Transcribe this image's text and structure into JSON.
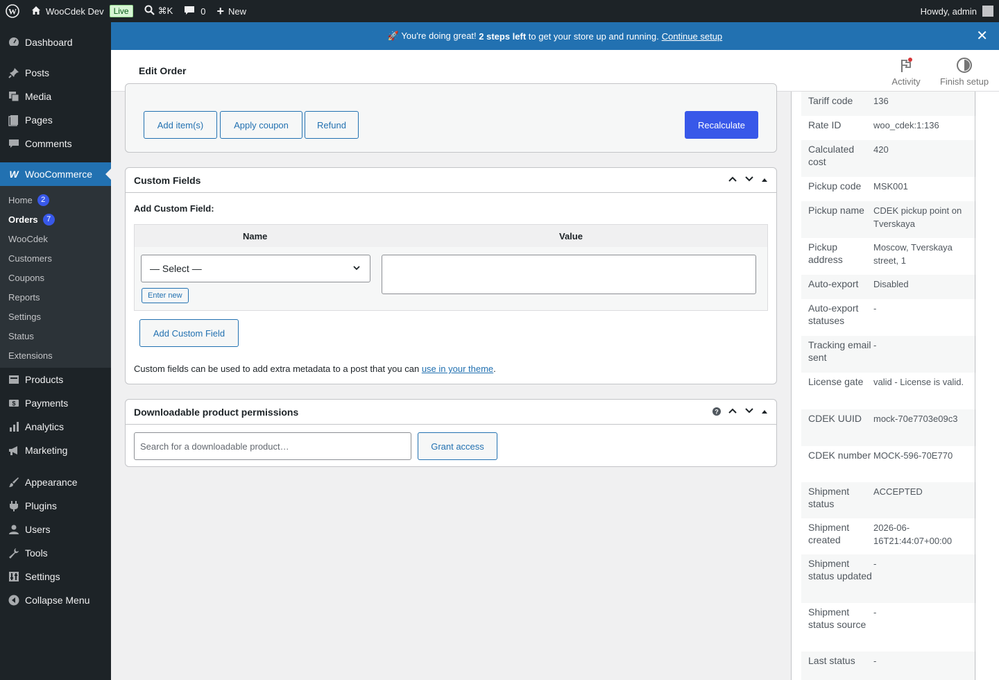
{
  "adminbar": {
    "site_name": "WooCdek Dev",
    "live_label": "Live",
    "search_shortcut": "⌘K",
    "comments_count": "0",
    "new_label": "New",
    "greeting": "Howdy, admin"
  },
  "sidebar": {
    "dashboard": "Dashboard",
    "posts": "Posts",
    "media": "Media",
    "pages": "Pages",
    "comments": "Comments",
    "woocommerce": "WooCommerce",
    "sub": {
      "home": "Home",
      "home_badge": "2",
      "orders": "Orders",
      "orders_badge": "7",
      "woocdek": "WooCdek",
      "customers": "Customers",
      "coupons": "Coupons",
      "reports": "Reports",
      "settings": "Settings",
      "status": "Status",
      "extensions": "Extensions"
    },
    "products": "Products",
    "payments": "Payments",
    "analytics": "Analytics",
    "marketing": "Marketing",
    "appearance": "Appearance",
    "plugins": "Plugins",
    "users": "Users",
    "tools": "Tools",
    "settings": "Settings",
    "collapse": "Collapse Menu"
  },
  "notice": {
    "text_before": "🚀 You're doing great! ",
    "bold": "2 steps left",
    "text_after": " to get your store up and running.",
    "link": "Continue setup"
  },
  "header": {
    "title": "Edit Order",
    "activity": "Activity",
    "finish_setup": "Finish setup"
  },
  "items_actions": {
    "add_items": "Add item(s)",
    "apply_coupon": "Apply coupon",
    "refund": "Refund",
    "recalculate": "Recalculate"
  },
  "custom_fields": {
    "title": "Custom Fields",
    "add_label": "Add Custom Field:",
    "col_name": "Name",
    "col_value": "Value",
    "select_value": "— Select —",
    "enter_new": "Enter new",
    "add_button": "Add Custom Field",
    "help_before": "Custom fields can be used to add extra metadata to a post that you can ",
    "help_link": "use in your theme",
    "help_after": "."
  },
  "downloads": {
    "title": "Downloadable product permissions",
    "search_placeholder": "Search for a downloadable product…",
    "grant_button": "Grant access"
  },
  "meta": [
    {
      "key": "Tariff code",
      "value": "136"
    },
    {
      "key": "Rate ID",
      "value": "woo_cdek:1:136"
    },
    {
      "key": "Calculated cost",
      "value": "420"
    },
    {
      "key": "Pickup code",
      "value": "MSK001"
    },
    {
      "key": "Pickup name",
      "value": "CDEK pickup point on Tverskaya"
    },
    {
      "key": "Pickup address",
      "value": "Moscow, Tverskaya street, 1"
    },
    {
      "key": "Auto-export",
      "value": "Disabled"
    },
    {
      "key": "Auto-export statuses",
      "value": "-"
    },
    {
      "key": "Tracking email sent",
      "value": "-"
    },
    {
      "key": "License gate",
      "value": "valid - License is valid."
    },
    {
      "key": "CDEK UUID",
      "value": "mock-70e7703e09c3"
    },
    {
      "key": "CDEK number",
      "value": "MOCK-596-70E770"
    },
    {
      "key": "Shipment status",
      "value": "ACCEPTED"
    },
    {
      "key": "Shipment created",
      "value": "2026-06-16T21:44:07+00:00"
    },
    {
      "key": "Shipment status updated",
      "value": "-"
    },
    {
      "key": "Shipment status source",
      "value": "-"
    },
    {
      "key": "Last status",
      "value": "-"
    }
  ],
  "colors": {
    "admin_dark": "#1d2327",
    "accent": "#2271b1",
    "primary_button": "#3858e9"
  }
}
